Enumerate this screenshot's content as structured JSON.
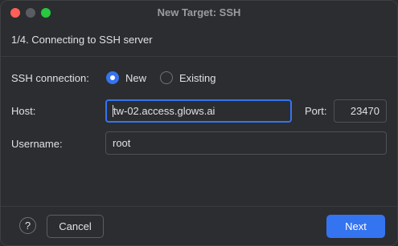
{
  "window": {
    "title": "New Target: SSH"
  },
  "step": {
    "title": "1/4. Connecting to SSH server"
  },
  "form": {
    "ssh_connection_label": "SSH connection:",
    "option_new": "New",
    "option_existing": "Existing",
    "selected_option": "New",
    "host_label": "Host:",
    "host_value": "tw-02.access.glows.ai",
    "port_label": "Port:",
    "port_value": "23470",
    "username_label": "Username:",
    "username_value": "root"
  },
  "footer": {
    "help_label": "?",
    "cancel_label": "Cancel",
    "next_label": "Next"
  },
  "colors": {
    "accent": "#3574f0",
    "background": "#2b2d30",
    "close": "#ff5f57",
    "maximize": "#28c840"
  }
}
